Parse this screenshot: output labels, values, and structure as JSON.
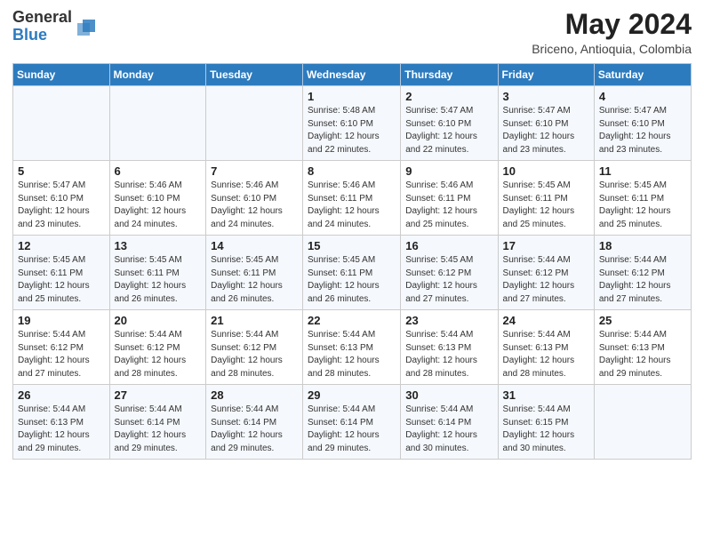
{
  "header": {
    "logo_general": "General",
    "logo_blue": "Blue",
    "month_title": "May 2024",
    "location": "Briceno, Antioquia, Colombia"
  },
  "weekdays": [
    "Sunday",
    "Monday",
    "Tuesday",
    "Wednesday",
    "Thursday",
    "Friday",
    "Saturday"
  ],
  "weeks": [
    [
      {
        "day": "",
        "info": ""
      },
      {
        "day": "",
        "info": ""
      },
      {
        "day": "",
        "info": ""
      },
      {
        "day": "1",
        "info": "Sunrise: 5:48 AM\nSunset: 6:10 PM\nDaylight: 12 hours\nand 22 minutes."
      },
      {
        "day": "2",
        "info": "Sunrise: 5:47 AM\nSunset: 6:10 PM\nDaylight: 12 hours\nand 22 minutes."
      },
      {
        "day": "3",
        "info": "Sunrise: 5:47 AM\nSunset: 6:10 PM\nDaylight: 12 hours\nand 23 minutes."
      },
      {
        "day": "4",
        "info": "Sunrise: 5:47 AM\nSunset: 6:10 PM\nDaylight: 12 hours\nand 23 minutes."
      }
    ],
    [
      {
        "day": "5",
        "info": "Sunrise: 5:47 AM\nSunset: 6:10 PM\nDaylight: 12 hours\nand 23 minutes."
      },
      {
        "day": "6",
        "info": "Sunrise: 5:46 AM\nSunset: 6:10 PM\nDaylight: 12 hours\nand 24 minutes."
      },
      {
        "day": "7",
        "info": "Sunrise: 5:46 AM\nSunset: 6:10 PM\nDaylight: 12 hours\nand 24 minutes."
      },
      {
        "day": "8",
        "info": "Sunrise: 5:46 AM\nSunset: 6:11 PM\nDaylight: 12 hours\nand 24 minutes."
      },
      {
        "day": "9",
        "info": "Sunrise: 5:46 AM\nSunset: 6:11 PM\nDaylight: 12 hours\nand 25 minutes."
      },
      {
        "day": "10",
        "info": "Sunrise: 5:45 AM\nSunset: 6:11 PM\nDaylight: 12 hours\nand 25 minutes."
      },
      {
        "day": "11",
        "info": "Sunrise: 5:45 AM\nSunset: 6:11 PM\nDaylight: 12 hours\nand 25 minutes."
      }
    ],
    [
      {
        "day": "12",
        "info": "Sunrise: 5:45 AM\nSunset: 6:11 PM\nDaylight: 12 hours\nand 25 minutes."
      },
      {
        "day": "13",
        "info": "Sunrise: 5:45 AM\nSunset: 6:11 PM\nDaylight: 12 hours\nand 26 minutes."
      },
      {
        "day": "14",
        "info": "Sunrise: 5:45 AM\nSunset: 6:11 PM\nDaylight: 12 hours\nand 26 minutes."
      },
      {
        "day": "15",
        "info": "Sunrise: 5:45 AM\nSunset: 6:11 PM\nDaylight: 12 hours\nand 26 minutes."
      },
      {
        "day": "16",
        "info": "Sunrise: 5:45 AM\nSunset: 6:12 PM\nDaylight: 12 hours\nand 27 minutes."
      },
      {
        "day": "17",
        "info": "Sunrise: 5:44 AM\nSunset: 6:12 PM\nDaylight: 12 hours\nand 27 minutes."
      },
      {
        "day": "18",
        "info": "Sunrise: 5:44 AM\nSunset: 6:12 PM\nDaylight: 12 hours\nand 27 minutes."
      }
    ],
    [
      {
        "day": "19",
        "info": "Sunrise: 5:44 AM\nSunset: 6:12 PM\nDaylight: 12 hours\nand 27 minutes."
      },
      {
        "day": "20",
        "info": "Sunrise: 5:44 AM\nSunset: 6:12 PM\nDaylight: 12 hours\nand 28 minutes."
      },
      {
        "day": "21",
        "info": "Sunrise: 5:44 AM\nSunset: 6:12 PM\nDaylight: 12 hours\nand 28 minutes."
      },
      {
        "day": "22",
        "info": "Sunrise: 5:44 AM\nSunset: 6:13 PM\nDaylight: 12 hours\nand 28 minutes."
      },
      {
        "day": "23",
        "info": "Sunrise: 5:44 AM\nSunset: 6:13 PM\nDaylight: 12 hours\nand 28 minutes."
      },
      {
        "day": "24",
        "info": "Sunrise: 5:44 AM\nSunset: 6:13 PM\nDaylight: 12 hours\nand 28 minutes."
      },
      {
        "day": "25",
        "info": "Sunrise: 5:44 AM\nSunset: 6:13 PM\nDaylight: 12 hours\nand 29 minutes."
      }
    ],
    [
      {
        "day": "26",
        "info": "Sunrise: 5:44 AM\nSunset: 6:13 PM\nDaylight: 12 hours\nand 29 minutes."
      },
      {
        "day": "27",
        "info": "Sunrise: 5:44 AM\nSunset: 6:14 PM\nDaylight: 12 hours\nand 29 minutes."
      },
      {
        "day": "28",
        "info": "Sunrise: 5:44 AM\nSunset: 6:14 PM\nDaylight: 12 hours\nand 29 minutes."
      },
      {
        "day": "29",
        "info": "Sunrise: 5:44 AM\nSunset: 6:14 PM\nDaylight: 12 hours\nand 29 minutes."
      },
      {
        "day": "30",
        "info": "Sunrise: 5:44 AM\nSunset: 6:14 PM\nDaylight: 12 hours\nand 30 minutes."
      },
      {
        "day": "31",
        "info": "Sunrise: 5:44 AM\nSunset: 6:15 PM\nDaylight: 12 hours\nand 30 minutes."
      },
      {
        "day": "",
        "info": ""
      }
    ]
  ]
}
